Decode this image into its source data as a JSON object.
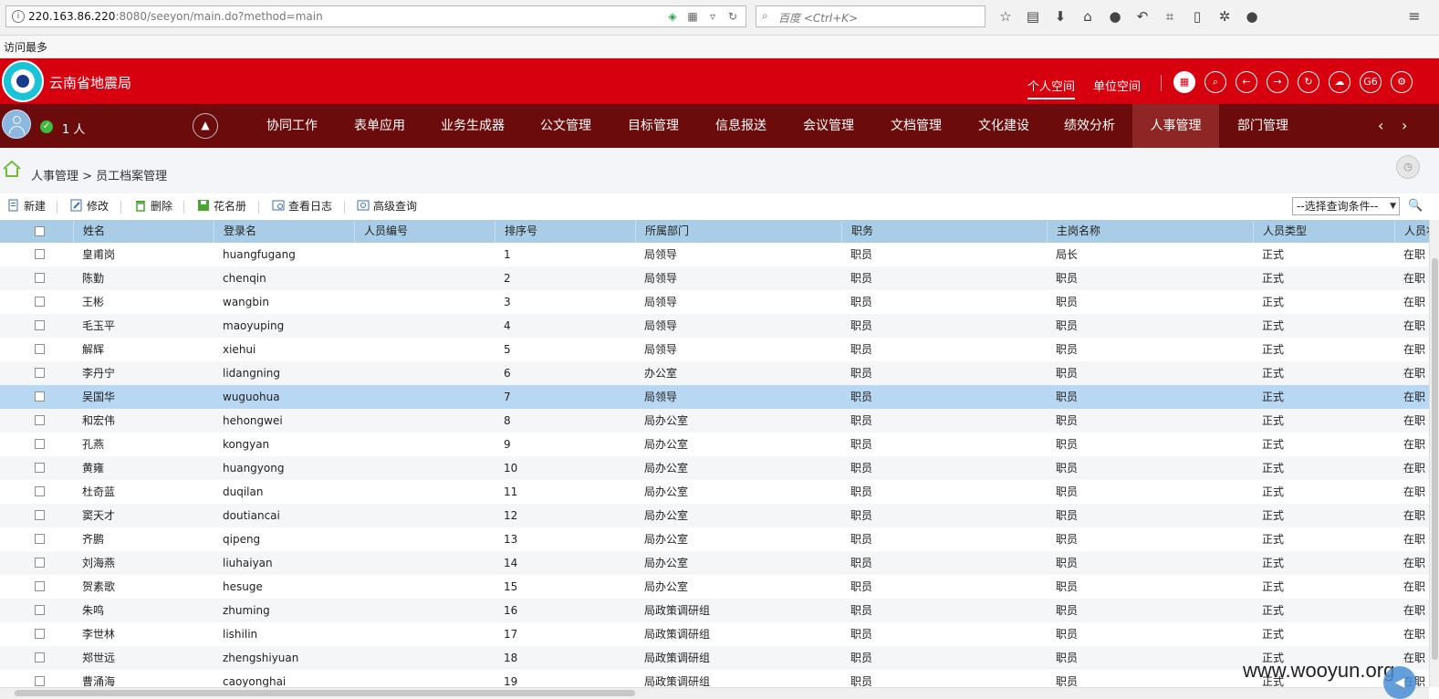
{
  "browser": {
    "url_host": "220.163.86.220",
    "url_path": ":8080/seeyon/main.do?method=main",
    "search_placeholder": "百度 <Ctrl+K>",
    "bookmark": "访问最多"
  },
  "header": {
    "app_title": "云南省地震局",
    "space_tabs": [
      "个人空间",
      "单位空间"
    ],
    "icon_g6": "G6"
  },
  "nav": {
    "online": "1 人",
    "items": [
      "协同工作",
      "表单应用",
      "业务生成器",
      "公文管理",
      "目标管理",
      "信息报送",
      "会议管理",
      "文档管理",
      "文化建设",
      "绩效分析",
      "人事管理",
      "部门管理"
    ],
    "active_index": 10
  },
  "breadcrumb": "人事管理 > 员工档案管理",
  "actions": {
    "new": "新建",
    "edit": "修改",
    "delete": "删除",
    "roster": "花名册",
    "log": "查看日志",
    "advanced": "高级查询",
    "query_select": "--选择查询条件--"
  },
  "table": {
    "columns": [
      "姓名",
      "登录名",
      "人员编号",
      "排序号",
      "所属部门",
      "职务",
      "主岗名称",
      "人员类型",
      "人员状"
    ],
    "selected_row": 6,
    "rows": [
      [
        "皇甫岗",
        "huangfugang",
        "",
        "1",
        "局领导",
        "职员",
        "局长",
        "正式",
        "在职"
      ],
      [
        "陈勤",
        "chenqin",
        "",
        "2",
        "局领导",
        "职员",
        "职员",
        "正式",
        "在职"
      ],
      [
        "王彬",
        "wangbin",
        "",
        "3",
        "局领导",
        "职员",
        "职员",
        "正式",
        "在职"
      ],
      [
        "毛玉平",
        "maoyuping",
        "",
        "4",
        "局领导",
        "职员",
        "职员",
        "正式",
        "在职"
      ],
      [
        "解辉",
        "xiehui",
        "",
        "5",
        "局领导",
        "职员",
        "职员",
        "正式",
        "在职"
      ],
      [
        "李丹宁",
        "lidangning",
        "",
        "6",
        "办公室",
        "职员",
        "职员",
        "正式",
        "在职"
      ],
      [
        "吴国华",
        "wuguohua",
        "",
        "7",
        "局领导",
        "职员",
        "职员",
        "正式",
        "在职"
      ],
      [
        "和宏伟",
        "hehongwei",
        "",
        "8",
        "局办公室",
        "职员",
        "职员",
        "正式",
        "在职"
      ],
      [
        "孔燕",
        "kongyan",
        "",
        "9",
        "局办公室",
        "职员",
        "职员",
        "正式",
        "在职"
      ],
      [
        "黄雍",
        "huangyong",
        "",
        "10",
        "局办公室",
        "职员",
        "职员",
        "正式",
        "在职"
      ],
      [
        "杜奇蓝",
        "duqilan",
        "",
        "11",
        "局办公室",
        "职员",
        "职员",
        "正式",
        "在职"
      ],
      [
        "窦天才",
        "doutiancai",
        "",
        "12",
        "局办公室",
        "职员",
        "职员",
        "正式",
        "在职"
      ],
      [
        "齐鹏",
        "qipeng",
        "",
        "13",
        "局办公室",
        "职员",
        "职员",
        "正式",
        "在职"
      ],
      [
        "刘海燕",
        "liuhaiyan",
        "",
        "14",
        "局办公室",
        "职员",
        "职员",
        "正式",
        "在职"
      ],
      [
        "贺素歌",
        "hesuge",
        "",
        "15",
        "局办公室",
        "职员",
        "职员",
        "正式",
        "在职"
      ],
      [
        "朱鸣",
        "zhuming",
        "",
        "16",
        "局政策调研组",
        "职员",
        "职员",
        "正式",
        "在职"
      ],
      [
        "李世林",
        "lishilin",
        "",
        "17",
        "局政策调研组",
        "职员",
        "职员",
        "正式",
        "在职"
      ],
      [
        "郑世远",
        "zhengshiyuan",
        "",
        "18",
        "局政策调研组",
        "职员",
        "职员",
        "正式",
        "在职"
      ],
      [
        "曹涌海",
        "caoyonghai",
        "",
        "19",
        "局政策调研组",
        "职员",
        "职员",
        "正式",
        "在职"
      ]
    ]
  },
  "watermark": "www.wooyun.org",
  "colors": {
    "header_red": "#d7000f",
    "nav_dark_red": "#6b0b0b",
    "grid_header": "#a9cde6",
    "selected_row": "#b8d7f3"
  }
}
